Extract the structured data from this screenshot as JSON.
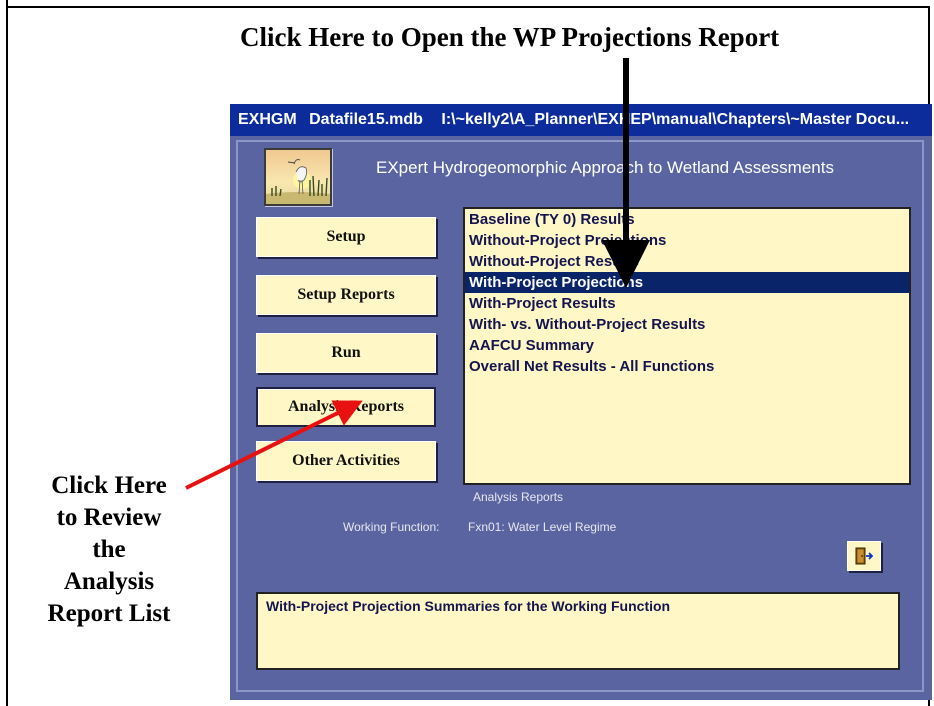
{
  "callouts": {
    "top": "Click Here to Open the WP Projections Report",
    "left_lines": [
      "Click Here",
      "to Review",
      "the",
      "Analysis",
      "Report List"
    ]
  },
  "window": {
    "title_app": "EXHGM",
    "title_db": "Datafile15.mdb",
    "title_path": "I:\\~kelly2\\A_Planner\\EXHEP\\manual\\Chapters\\~Master Docu...",
    "app_title": "EXpert Hydrogeomorphic Approach to Wetland Assessments"
  },
  "nav": {
    "setup": "Setup",
    "setup_reports": "Setup Reports",
    "run": "Run",
    "analysis_reports": "Analysis Reports",
    "other_activities": "Other Activities"
  },
  "reports": [
    "Baseline (TY 0) Results",
    "Without-Project Projections",
    "Without-Project Results",
    "With-Project Projections",
    "With-Project Results",
    "With- vs. Without-Project Results",
    "AAFCU Summary",
    "Overall Net Results - All Functions"
  ],
  "selected_report": "With-Project Projections",
  "list_caption": "Analysis Reports",
  "working_function": {
    "label": "Working Function:",
    "value": "Fxn01: Water Level Regime"
  },
  "description": "With-Project Projection Summaries for the Working Function",
  "icons": {
    "logo": "heron-wetland-logo",
    "exit": "exit-door-icon"
  },
  "colors": {
    "window_bg": "#5a64a0",
    "title_bar": "#0c2c9c",
    "button_bg": "#fff8c6",
    "selection": "#0a246a",
    "arrow_red": "#e81010"
  }
}
